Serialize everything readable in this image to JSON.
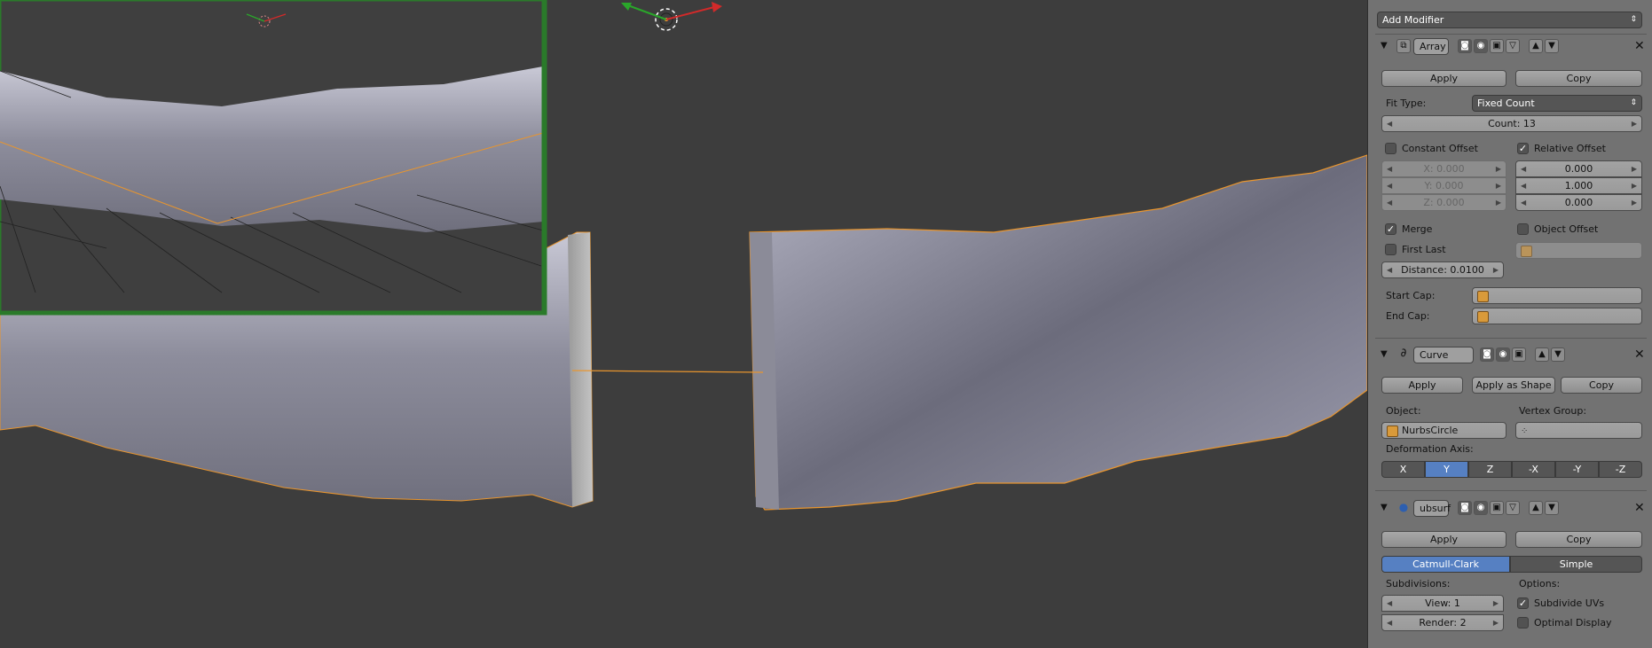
{
  "panel": {
    "add_modifier": "Add Modifier",
    "array": {
      "name": "Array",
      "apply": "Apply",
      "copy": "Copy",
      "fit_type_label": "Fit Type:",
      "fit_type_value": "Fixed Count",
      "count": "Count: 13",
      "constant_offset": "Constant Offset",
      "relative_offset": "Relative Offset",
      "const_x": "X: 0.000",
      "const_y": "Y: 0.000",
      "const_z": "Z: 0.000",
      "rel_x": "0.000",
      "rel_y": "1.000",
      "rel_z": "0.000",
      "merge": "Merge",
      "object_offset": "Object Offset",
      "first_last": "First Last",
      "distance": "Distance: 0.0100",
      "start_cap": "Start Cap:",
      "end_cap": "End Cap:",
      "relative_offset_checked": true,
      "merge_checked": true,
      "constant_offset_checked": false,
      "first_last_checked": false,
      "object_offset_checked": false
    },
    "curve": {
      "name": "Curve",
      "apply": "Apply",
      "apply_as_shape": "Apply as Shape",
      "copy": "Copy",
      "object_label": "Object:",
      "vertex_group_label": "Vertex Group:",
      "object_value": "NurbsCircle",
      "deformation_axis_label": "Deformation Axis:",
      "axes": [
        "X",
        "Y",
        "Z",
        "-X",
        "-Y",
        "-Z"
      ],
      "selected_axis": "Y"
    },
    "subsurf": {
      "name": "ubsurf",
      "apply": "Apply",
      "copy": "Copy",
      "catmull_clark": "Catmull-Clark",
      "simple": "Simple",
      "subdivisions_label": "Subdivisions:",
      "options_label": "Options:",
      "view": "View: 1",
      "render": "Render: 2",
      "subdivide_uvs": "Subdivide UVs",
      "optimal_display": "Optimal Display",
      "subdivide_uvs_checked": true,
      "optimal_display_checked": false
    }
  },
  "icons": {
    "collapse": "triangle-down-icon",
    "array_type": "array-modifier-icon",
    "curve_type": "curve-modifier-icon",
    "subsurf_type": "subsurf-modifier-icon",
    "render": "camera-icon",
    "view": "eye-icon",
    "edit": "edit-mode-icon",
    "cage": "cage-icon",
    "move_up": "arrow-up-icon",
    "move_down": "arrow-down-icon",
    "close": "close-icon"
  },
  "colors": {
    "viewport_bg": "#3d3d3d",
    "panel_bg": "#727272",
    "selection_orange": "#e8952e",
    "active_blue": "#5680c2",
    "mesh_gray": "#9a9aa8"
  }
}
